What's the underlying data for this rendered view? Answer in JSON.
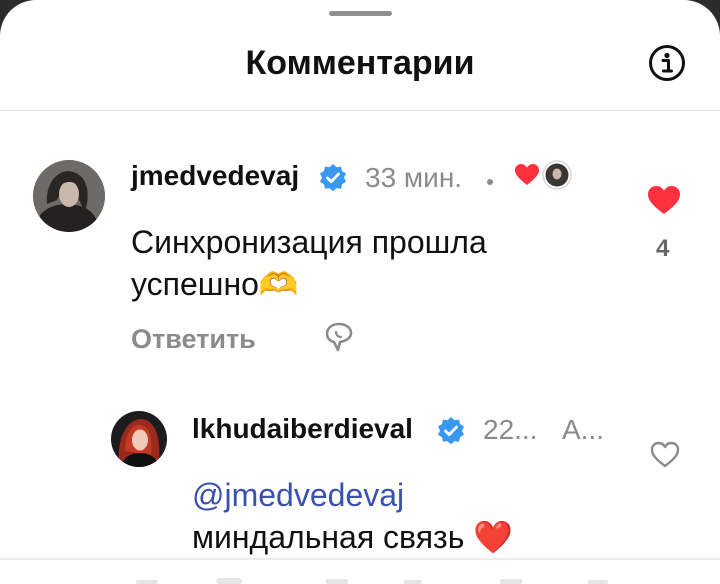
{
  "header": {
    "title": "Комментарии",
    "info_icon": "info-icon"
  },
  "comments": [
    {
      "username": "jmedvedevaj",
      "verified": true,
      "time": "33 мин.",
      "text": "Синхронизация прошла успешно🫶",
      "reply_label": "Ответить",
      "like_count": "4",
      "liked": true
    }
  ],
  "replies": [
    {
      "username": "lkhudaiberdieval",
      "verified": true,
      "time": "22...",
      "extra": "А...",
      "mention": "@jmedvedevaj",
      "text": "миндальная связь ❤️",
      "liked": false
    }
  ],
  "colors": {
    "like_red": "#ff3040",
    "verified_blue": "#3897f0",
    "mention_blue": "#3a51b0",
    "muted": "#8b8b8b"
  }
}
